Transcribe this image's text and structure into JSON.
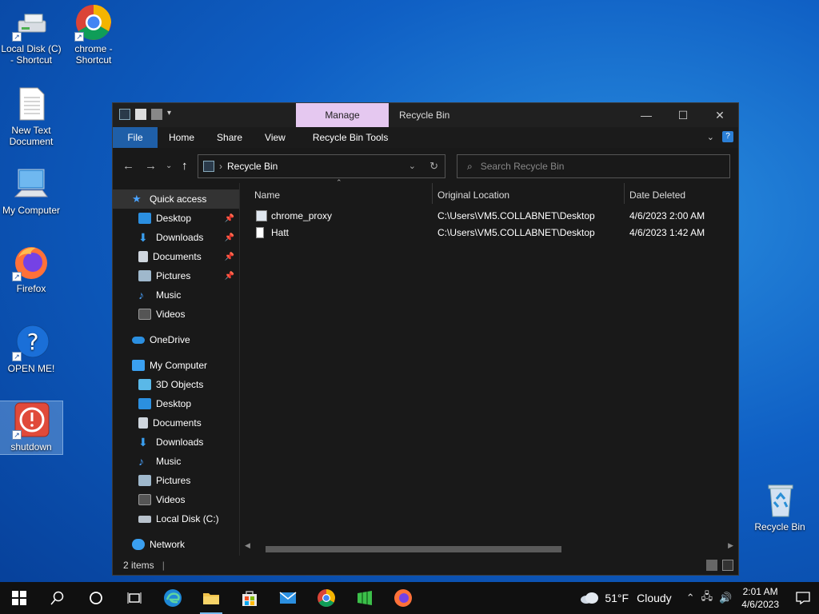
{
  "desktop": {
    "icons": [
      {
        "label": "Local Disk (C) - Shortcut",
        "icon": "drive-icon"
      },
      {
        "label": "chrome - Shortcut",
        "icon": "chrome-icon"
      },
      {
        "label": "New Text Document",
        "icon": "text-document-icon"
      },
      {
        "label": "My Computer",
        "icon": "computer-icon"
      },
      {
        "label": "Firefox",
        "icon": "firefox-icon"
      },
      {
        "label": "OPEN ME!",
        "icon": "help-icon"
      },
      {
        "label": "shutdown",
        "icon": "shutdown-icon"
      },
      {
        "label": "Recycle Bin",
        "icon": "recycle-bin-icon"
      }
    ]
  },
  "window": {
    "title": "Recycle Bin",
    "manage_tab": "Manage",
    "ribbon": {
      "file": "File",
      "home": "Home",
      "share": "Share",
      "view": "View",
      "tools": "Recycle Bin Tools"
    },
    "address": "Recycle Bin",
    "search_placeholder": "Search Recycle Bin",
    "columns": {
      "name": "Name",
      "location": "Original Location",
      "date": "Date Deleted"
    },
    "rows": [
      {
        "name": "chrome_proxy",
        "location": "C:\\Users\\VM5.COLLABNET\\Desktop",
        "date": "4/6/2023 2:00 AM"
      },
      {
        "name": "Hatt",
        "location": "C:\\Users\\VM5.COLLABNET\\Desktop",
        "date": "4/6/2023 1:42 AM"
      }
    ],
    "status": "2 items"
  },
  "sidebar": {
    "quick_access": "Quick access",
    "quick_items": [
      "Desktop",
      "Downloads",
      "Documents",
      "Pictures",
      "Music",
      "Videos"
    ],
    "onedrive": "OneDrive",
    "my_computer": "My Computer",
    "pc_items": [
      "3D Objects",
      "Desktop",
      "Documents",
      "Downloads",
      "Music",
      "Pictures",
      "Videos",
      "Local Disk (C:)"
    ],
    "network": "Network"
  },
  "taskbar": {
    "weather_temp": "51°F",
    "weather_text": "Cloudy",
    "time": "2:01 AM",
    "date": "4/6/2023"
  },
  "colors": {
    "accent": "#1f5fa8",
    "manage_tab": "#e5c8f0",
    "desktop": "#0f5fc4"
  }
}
